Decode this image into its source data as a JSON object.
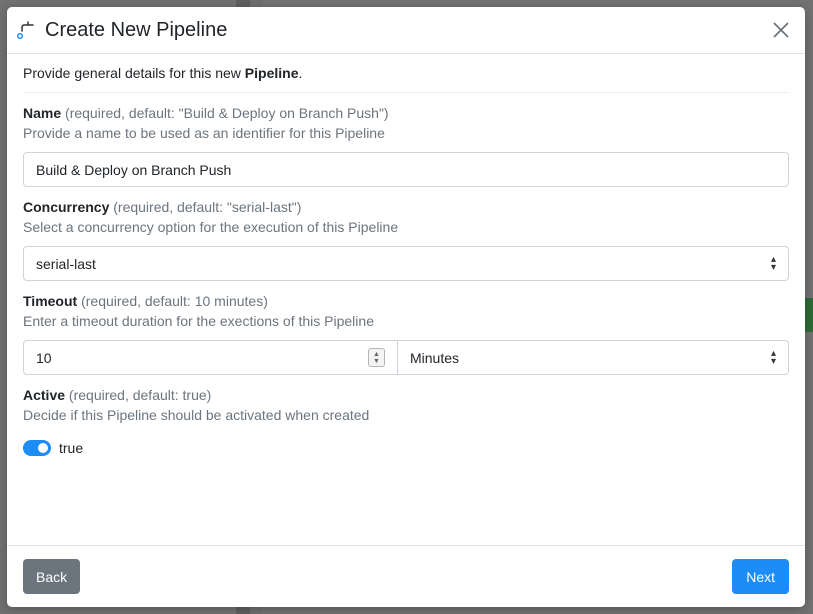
{
  "modal": {
    "title": "Create New Pipeline",
    "intro_prefix": "Provide general details for this new ",
    "intro_bold": "Pipeline",
    "intro_suffix": "."
  },
  "fields": {
    "name": {
      "label": "Name",
      "hint": " (required, default: \"Build & Deploy on Branch Push\")",
      "help": "Provide a name to be used as an identifier for this Pipeline",
      "value": "Build & Deploy on Branch Push"
    },
    "concurrency": {
      "label": "Concurrency",
      "hint": " (required, default: \"serial-last\")",
      "help": "Select a concurrency option for the execution of this Pipeline",
      "value": "serial-last"
    },
    "timeout": {
      "label": "Timeout",
      "hint": " (required, default: 10 minutes)",
      "help": "Enter a timeout duration for the exections of this Pipeline",
      "value": "10",
      "unit": "Minutes"
    },
    "active": {
      "label": "Active",
      "hint": " (required, default: true)",
      "help": "Decide if this Pipeline should be activated when created",
      "toggle_label": "true",
      "checked": true
    }
  },
  "footer": {
    "back_label": "Back",
    "next_label": "Next"
  },
  "colors": {
    "primary": "#1e8cf5",
    "secondary": "#6c757d"
  }
}
